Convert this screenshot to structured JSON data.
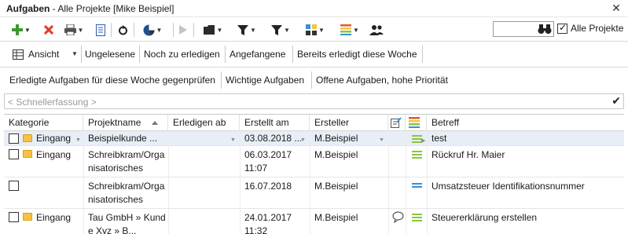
{
  "window": {
    "title_bold": "Aufgaben",
    "title_rest": " - Alle Projekte [Mike Beispiel]",
    "close_glyph": "✕"
  },
  "toolbar": {
    "search_value": "",
    "all_projects_label": "Alle Projekte",
    "all_projects_checked": true
  },
  "view_filters": [
    "Ansicht",
    "Ungelesene",
    "Noch zu erledigen",
    "Angefangene",
    "Bereits erledigt diese Woche"
  ],
  "saved_filters": [
    "Erledigte Aufgaben für diese Woche gegenprüfen",
    "Wichtige Aufgaben",
    "Offene Aufgaben, hohe Priorität"
  ],
  "quick_entry": {
    "placeholder": "< Schnellerfassung >"
  },
  "columns": [
    "Kategorie",
    "Projektname",
    "Erledigen ab",
    "Erstellt am",
    "Ersteller",
    "",
    "",
    "Betreff"
  ],
  "rows": [
    {
      "category": "Eingang",
      "project": "Beispielkunde ...",
      "due": "",
      "created": "03.08.2018 ...",
      "creator": "M.Beispiel",
      "note": false,
      "priority": "green",
      "subject": "test",
      "selected": true
    },
    {
      "category": "Eingang",
      "project": "Schreibkram/Organisatorisches",
      "due": "",
      "created_date": "06.03.2017",
      "created_time": "11:07",
      "creator": "M.Beispiel",
      "note": false,
      "priority": "green",
      "subject": "Rückruf Hr. Maier",
      "selected": false
    },
    {
      "category": "",
      "project": "Schreibkram/Organisatorisches",
      "due": "",
      "created_date": "16.07.2018",
      "created_time": "",
      "creator": "M.Beispiel",
      "note": false,
      "priority": "blue",
      "subject": "Umsatzsteuer Identifikationsnummer",
      "selected": false
    },
    {
      "category": "Eingang",
      "project": "Tau GmbH » Kunde Xyz » B...",
      "due": "",
      "created_date": "24.01.2017",
      "created_time": "11:32",
      "creator": "M.Beispiel",
      "note": true,
      "priority": "green",
      "subject": "Steuererklärung erstellen",
      "selected": false
    }
  ],
  "colors": {
    "priority_green": "#8cc63f",
    "priority_blue": "#3b8fd6",
    "folder": "#f5c242",
    "selected_row": "#e8eef6"
  }
}
